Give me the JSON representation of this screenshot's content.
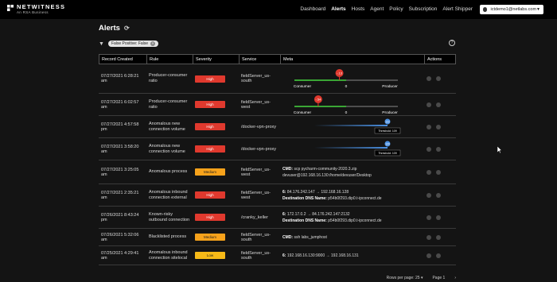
{
  "brand": {
    "name": "NETWITNESS",
    "subtitle": "An RSA Business"
  },
  "nav": [
    "Dashboard",
    "Alerts",
    "Hosts",
    "Agent",
    "Policy",
    "Subscription",
    "Alert Shipper"
  ],
  "active_nav": "Alerts",
  "user": {
    "email": "ictdemo1@netlabs.com"
  },
  "page": {
    "title": "Alerts"
  },
  "filter": {
    "chip_label": "False Positive: False"
  },
  "table": {
    "headers": [
      "Record Created",
      "Rule",
      "Severity",
      "Service",
      "Meta",
      "Actions"
    ],
    "rows": [
      {
        "created": "07/27/2021 6:28:21 am",
        "rule": "Producer-consumer ratio",
        "severity": "High",
        "service": "fieldServer_us-south",
        "meta_type": "ratio",
        "ratio_value": "-.13",
        "ratio": -0.13,
        "left_label": "Consumer",
        "mid_label": "0",
        "right_label": "Producer"
      },
      {
        "created": "07/27/2021 6:02:57 am",
        "rule": "Producer-consumer ratio",
        "severity": "High",
        "service": "fieldServer_us-west",
        "meta_type": "ratio",
        "ratio_value": "-.54",
        "ratio": -0.54,
        "left_label": "Consumer",
        "mid_label": "0",
        "right_label": "Producer"
      },
      {
        "created": "07/27/2021 4:57:58 pm",
        "rule": "Anomalous new connection volume",
        "severity": "High",
        "service": "/docker-vpn-proxy",
        "meta_type": "volume",
        "volume_value": "122",
        "threshold_label": "Threshold: 109"
      },
      {
        "created": "07/27/2021 3:58:20 am",
        "rule": "Anomalous new connection volume",
        "severity": "High",
        "service": "/docker-vpn-proxy",
        "meta_type": "volume",
        "volume_value": "120",
        "threshold_label": "Threshold: 109"
      },
      {
        "created": "07/27/2021 3:25:05 am",
        "rule": "Anomalous process",
        "severity": "Medium",
        "service": "fieldServer_us-west",
        "meta_type": "text",
        "line1_label": "CMD:",
        "line1_value": "scp pycharm-community-2020.3.zip",
        "line2_label": "",
        "line2_value": "devuser@192.168.16.130:/home/devuser/Desktop"
      },
      {
        "created": "07/27/2021 2:35:21 am",
        "rule": "Anomalous inbound connection external",
        "severity": "High",
        "service": "fieldServer_us-west",
        "meta_type": "conn",
        "line1_label": "6:",
        "src": "84.176.242.147",
        "dst": "192.168.16.128",
        "line2_label": "Destination DNS Name:",
        "line2_value": "p54b0f293.dip0.t-ipconnect.de"
      },
      {
        "created": "07/26/2021 8:43:24 pm",
        "rule": "Known-risky outbound connection",
        "severity": "High",
        "service": "/cranky_keller",
        "meta_type": "conn",
        "line1_label": "6:",
        "src": "172.17.0.2",
        "dst": "84.176.242.147:2132",
        "line2_label": "Destination DNS Name:",
        "line2_value": "p54b0f293.dip0.t-ipconnect.de"
      },
      {
        "created": "07/26/2021 5:32:06 am",
        "rule": "Blacklisted process",
        "severity": "Medium",
        "service": "fieldServer_us-south",
        "meta_type": "text",
        "line1_label": "CMD:",
        "line1_value": "ssh labs_jumphost",
        "line2_label": "",
        "line2_value": ""
      },
      {
        "created": "07/25/2021 4:29:41 am",
        "rule": "Anomalous inbound connection sitelocal",
        "severity": "Low",
        "service": "fieldServer_us-south",
        "meta_type": "conn1",
        "line1_label": "6:",
        "src": "192.168.16.130:9000",
        "dst": "192.168.16.131"
      }
    ]
  },
  "pager": {
    "rows_per_page_label": "Rows per page:",
    "rows_per_page": "25",
    "page_label": "Page 1"
  },
  "colors": {
    "high": "#e0392e",
    "medium": "#f7a21b",
    "low": "#f6b917",
    "ratio_bar": "#3aa635",
    "volume_bar": "#4a90e2"
  }
}
